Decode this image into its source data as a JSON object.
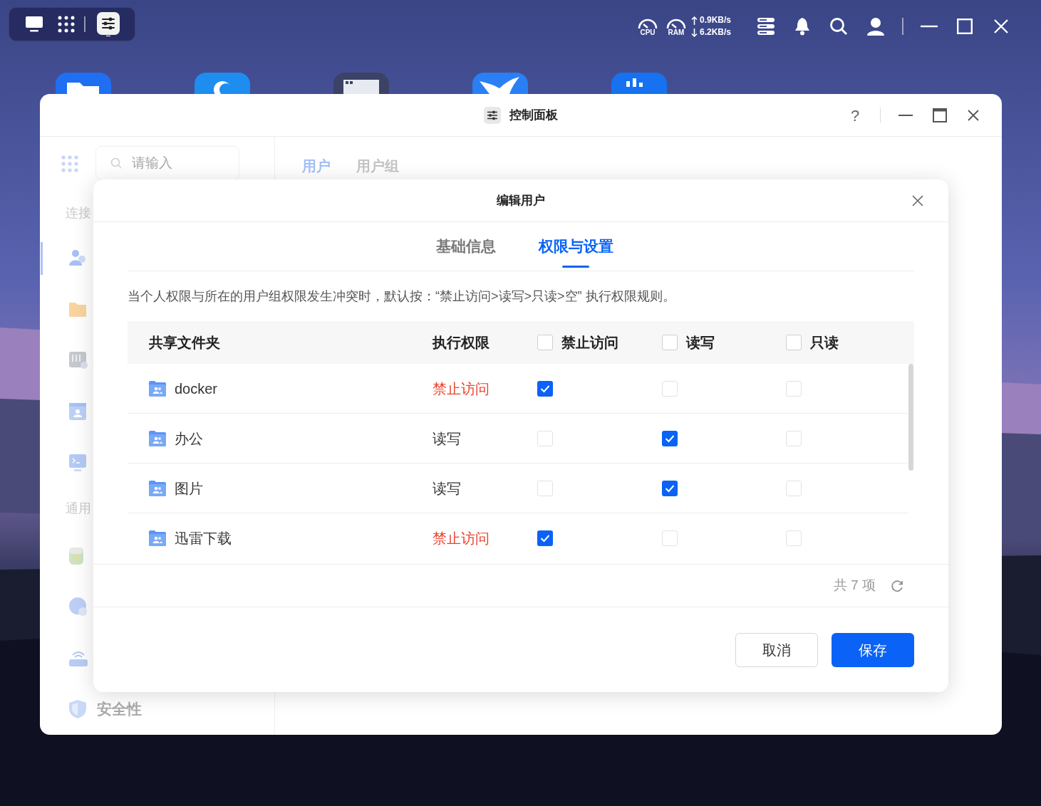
{
  "top_bar": {
    "gauges": [
      {
        "label": "CPU"
      },
      {
        "label": "RAM"
      }
    ],
    "upload": "0.9KB/s",
    "download": "6.2KB/s"
  },
  "window": {
    "title": "控制面板",
    "help": "?"
  },
  "sidebar": {
    "search": {
      "placeholder": "请输入"
    },
    "items": [
      {
        "kind": "heading",
        "label": "连接"
      },
      {
        "kind": "entry",
        "selected": true
      },
      {
        "kind": "entry",
        "selected": false
      },
      {
        "kind": "entry",
        "selected": false
      },
      {
        "kind": "entry",
        "selected": false
      },
      {
        "kind": "entry",
        "selected": false
      },
      {
        "kind": "heading",
        "label": "通用"
      },
      {
        "kind": "entry",
        "selected": false
      },
      {
        "kind": "entry",
        "selected": false
      },
      {
        "kind": "entry",
        "selected": false
      },
      {
        "kind": "entry",
        "selected": false,
        "label": "安全性"
      }
    ]
  },
  "main_tabs": [
    {
      "label": "用户",
      "selected": true
    },
    {
      "label": "用户组",
      "selected": false
    }
  ],
  "dialog": {
    "title": "编辑用户",
    "tabs": [
      {
        "label": "基础信息",
        "selected": false
      },
      {
        "label": "权限与设置",
        "selected": true
      }
    ],
    "notice": "当个人权限与所在的用户组权限发生冲突时，默认按：“禁止访问>读写>只读>空” 执行权限规则。",
    "table": {
      "columns": [
        {
          "label": "共享文件夹",
          "kind": "text"
        },
        {
          "label": "执行权限",
          "kind": "text"
        },
        {
          "label": "禁止访问",
          "kind": "checkbox",
          "checked": false
        },
        {
          "label": "读写",
          "kind": "checkbox",
          "checked": false
        },
        {
          "label": "只读",
          "kind": "checkbox",
          "checked": false
        }
      ],
      "rows": [
        {
          "folder": "docker",
          "permission": "禁止访问",
          "color": "#e8442f",
          "deny": true,
          "read_write": false,
          "read_only": false
        },
        {
          "folder": "办公",
          "permission": "读写",
          "color": "#333333",
          "deny": false,
          "read_write": true,
          "read_only": false
        },
        {
          "folder": "图片",
          "permission": "读写",
          "color": "#333333",
          "deny": false,
          "read_write": true,
          "read_only": false
        },
        {
          "folder": "迅雷下载",
          "permission": "禁止访问",
          "color": "#e8442f",
          "deny": true,
          "read_write": false,
          "read_only": false
        }
      ]
    },
    "count": "共 7 项",
    "buttons": [
      {
        "label": "取消",
        "kind": "secondary"
      },
      {
        "label": "保存",
        "kind": "primary"
      }
    ]
  }
}
